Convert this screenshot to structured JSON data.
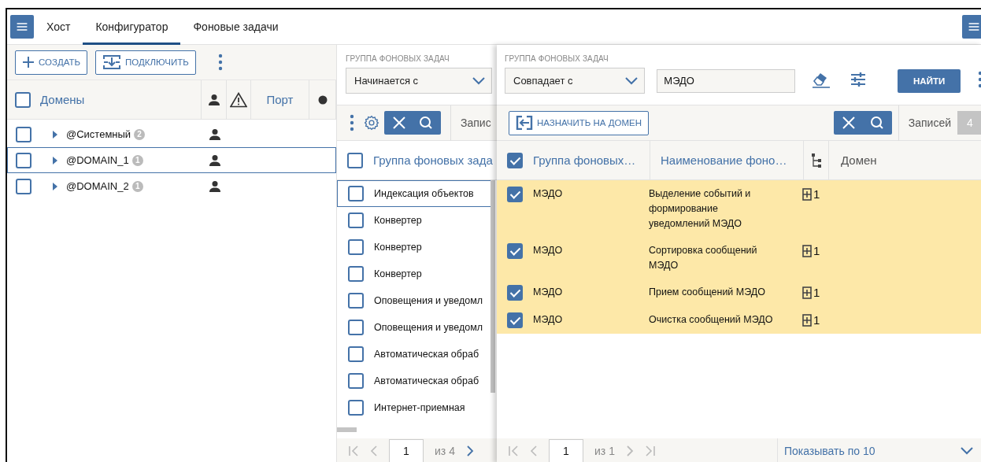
{
  "tabs": [
    {
      "label": "Хост",
      "selected": false
    },
    {
      "label": "Конфигуратор",
      "selected": true
    },
    {
      "label": "Фоновые задачи",
      "selected": false
    }
  ],
  "domains": {
    "buttons": [
      {
        "kind": "create",
        "label": "СОЗДАТЬ"
      },
      {
        "kind": "connect",
        "label": "ПОДКЛЮЧИТЬ"
      }
    ],
    "header_checked": false,
    "columns": [
      {
        "kind": "text",
        "label": "Домены"
      },
      {
        "kind": "person"
      },
      {
        "kind": "warning"
      },
      {
        "kind": "text",
        "label": "Порт"
      },
      {
        "kind": "dot"
      }
    ],
    "rows": [
      {
        "name": "@Системный",
        "count": "2",
        "checked": false,
        "selected": false
      },
      {
        "name": "@DOMAIN_1",
        "count": "1",
        "checked": false,
        "selected": true
      },
      {
        "name": "@DOMAIN_2",
        "count": "1",
        "checked": false,
        "selected": false
      }
    ]
  },
  "task_groups": {
    "filter_label": "ГРУППА ФОНОВЫХ ЗАДАЧ",
    "condition": "Начинается с",
    "records_label": "Запис",
    "header_checked": false,
    "column": "Группа фоновых зада",
    "rows": [
      {
        "name": "Индексация объектов",
        "checked": false,
        "selected": true
      },
      {
        "name": "Конвертер",
        "checked": false,
        "selected": false
      },
      {
        "name": "Конвертер",
        "checked": false,
        "selected": false
      },
      {
        "name": "Конвертер",
        "checked": false,
        "selected": false
      },
      {
        "name": "Оповещения и уведомл",
        "checked": false,
        "selected": false
      },
      {
        "name": "Оповещения и уведомл",
        "checked": false,
        "selected": false
      },
      {
        "name": "Автоматическая обраб",
        "checked": false,
        "selected": false
      },
      {
        "name": "Автоматическая обраб",
        "checked": false,
        "selected": false
      },
      {
        "name": "Интернет-приемная",
        "checked": false,
        "selected": false
      }
    ],
    "pager": {
      "page": "1",
      "of": "из 4"
    }
  },
  "results": {
    "filter_label": "ГРУППА ФОНОВЫХ ЗАДАЧ",
    "condition": "Совпадает с",
    "query": "МЭДО",
    "search_button": "НАЙТИ",
    "assign_button": "НАЗНАЧИТЬ НА ДОМЕН",
    "records_label": "Записей",
    "records_count": "4",
    "header_checked": true,
    "columns": [
      "Группа фоновых…",
      "Наименование фоно…",
      "Домен"
    ],
    "rows": [
      {
        "group": "МЭДО",
        "name": "Выделение событий и формирование уведомлений МЭДО",
        "count": "1",
        "checked": true
      },
      {
        "group": "МЭДО",
        "name": "Сортировка сообщений МЭДО",
        "count": "1",
        "checked": true
      },
      {
        "group": "МЭДО",
        "name": "Прием сообщений МЭДО",
        "count": "1",
        "checked": true
      },
      {
        "group": "МЭДО",
        "name": "Очистка сообщений МЭДО",
        "count": "1",
        "checked": true
      }
    ],
    "pager": {
      "page": "1",
      "of": "из 1"
    },
    "page_size": "Показывать по 10"
  }
}
